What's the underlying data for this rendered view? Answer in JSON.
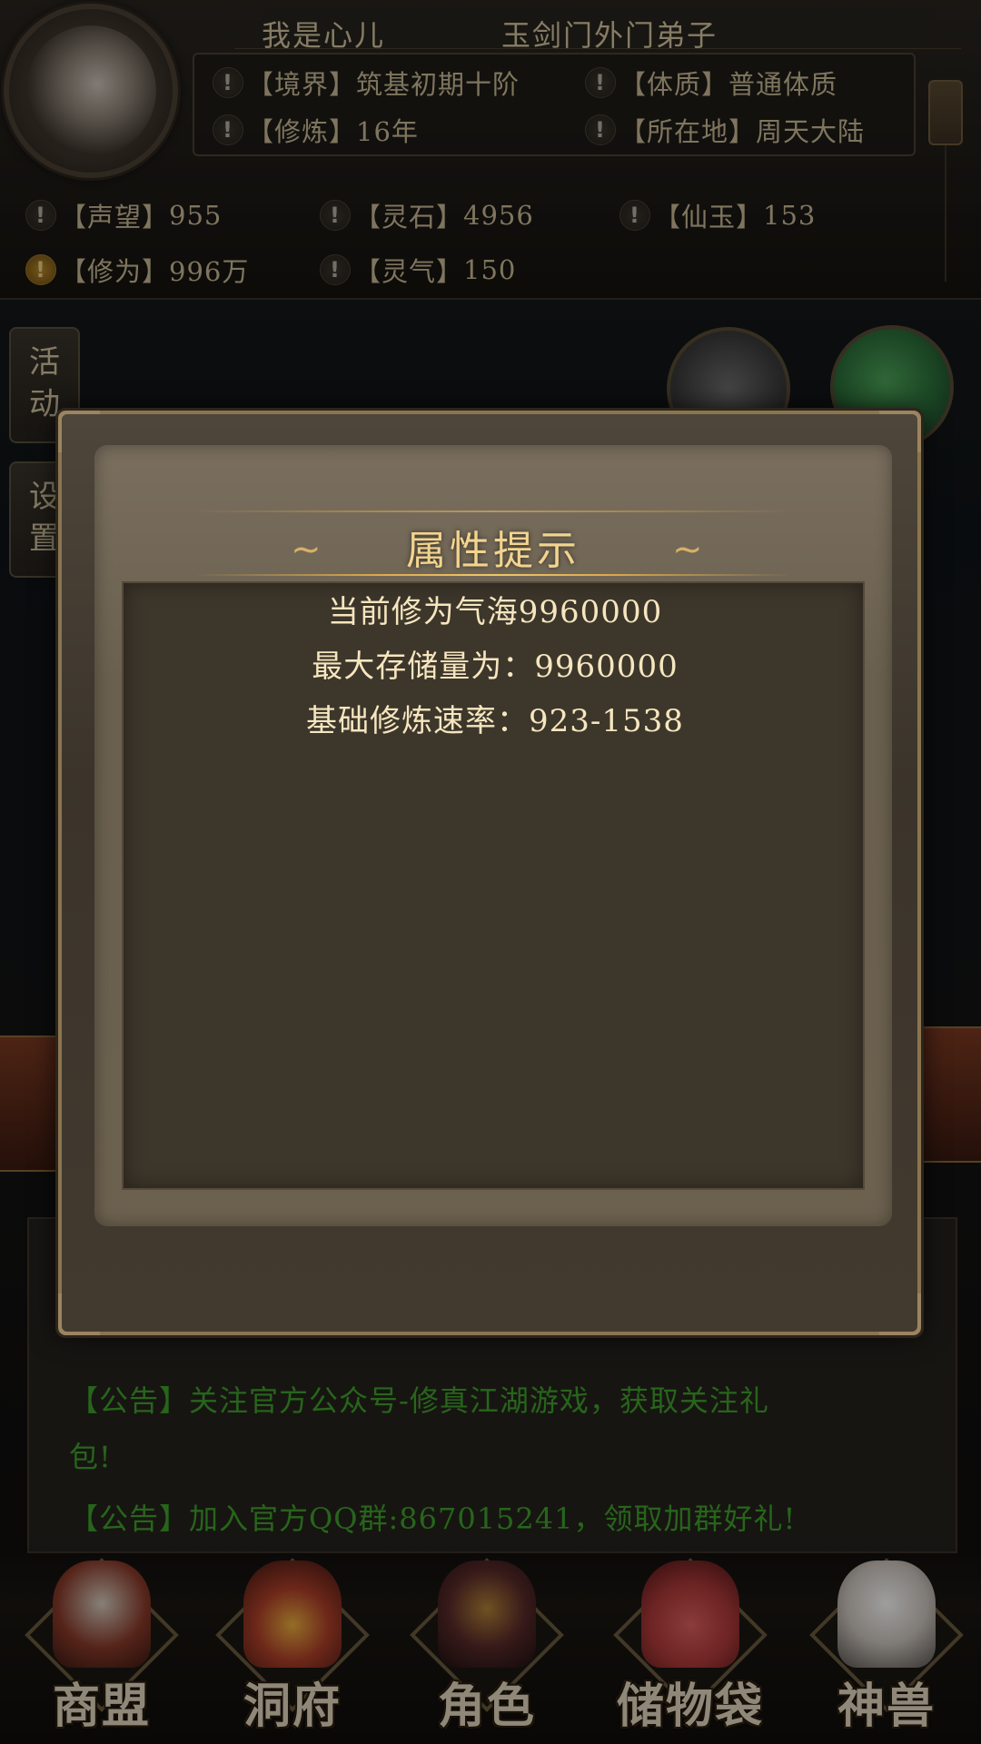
{
  "header": {
    "player_name": "我是心儿",
    "player_title": "玉剑门外门弟子",
    "info": [
      {
        "label": "【境界】",
        "value": "筑基初期十阶"
      },
      {
        "label": "【体质】",
        "value": "普通体质"
      },
      {
        "label": "【修炼】",
        "value": "16年"
      },
      {
        "label": "【所在地】",
        "value": "周天大陆"
      }
    ],
    "resources": [
      {
        "label": "【声望】",
        "value": "955"
      },
      {
        "label": "【灵石】",
        "value": "4956"
      },
      {
        "label": "【仙玉】",
        "value": "153"
      },
      {
        "label": "【修为】",
        "value": "996万"
      },
      {
        "label": "【灵气】",
        "value": "150"
      }
    ],
    "warn_glyph": "!"
  },
  "side_menu": {
    "activity": [
      "活",
      "动"
    ],
    "settings": [
      "设",
      "置"
    ]
  },
  "modal": {
    "title": "属性提示",
    "lines": [
      "当前修为气海9960000",
      "最大存储量为：9960000",
      "基础修炼速率：923-1538"
    ]
  },
  "chat": {
    "lines": [
      "【公告】关注官方公众号-修真江湖游戏，获取关注礼",
      "包!",
      "【公告】加入官方QQ群:867015241，领取加群好礼!"
    ]
  },
  "bottom_nav": [
    {
      "label": "商盟",
      "icon": "merchant-house-icon",
      "color": "#8a3a2a"
    },
    {
      "label": "洞府",
      "icon": "cave-shrine-icon",
      "color": "#b0402a"
    },
    {
      "label": "角色",
      "icon": "warrior-helmet-icon",
      "color": "#5a2a2a"
    },
    {
      "label": "储物袋",
      "icon": "storage-bag-icon",
      "color": "#b03a3a"
    },
    {
      "label": "神兽",
      "icon": "fox-spirit-icon",
      "color": "#cfc7c0"
    }
  ]
}
